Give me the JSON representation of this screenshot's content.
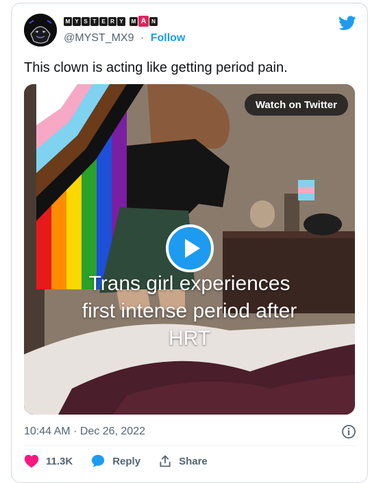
{
  "author": {
    "display_name_tiles": [
      "M",
      "Y",
      "S",
      "T",
      "E",
      "R",
      "Y",
      "M",
      "A",
      "N"
    ],
    "handle": "@MYST_MX9",
    "separator": "·",
    "follow_label": "Follow"
  },
  "tweet": {
    "text": "This clown is acting like getting period pain."
  },
  "media": {
    "watch_label": "Watch on Twitter",
    "caption_lines": [
      "Trans girl experiences",
      "first intense period after",
      "HRT"
    ]
  },
  "meta": {
    "timestamp": "10:44 AM · Dec 26, 2022"
  },
  "actions": {
    "likes": "11.3K",
    "reply_label": "Reply",
    "share_label": "Share"
  },
  "colors": {
    "twitter_blue": "#1d9bf0",
    "like_red": "#f91880",
    "muted": "#536471",
    "name_accent": "#e0245e"
  },
  "icons": [
    "avatar-mask-icon",
    "twitter-bird-icon",
    "play-icon",
    "info-icon",
    "heart-icon",
    "reply-bubble-icon",
    "share-icon"
  ]
}
